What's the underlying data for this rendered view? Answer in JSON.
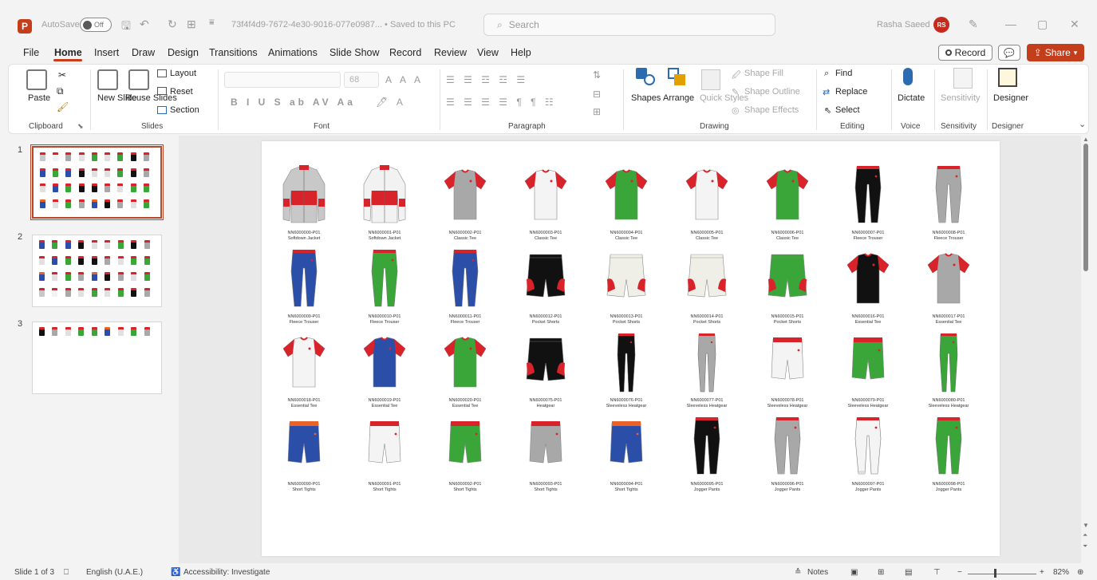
{
  "titlebar": {
    "app_letter": "P",
    "autosave_label": "AutoSave",
    "autosave_state": "Off",
    "filename": "73f4f4d9-7672-4e30-9016-077e0987... • Saved to this PC",
    "search_placeholder": "Search",
    "user_name": "Rasha Saeed",
    "user_initials": "RS"
  },
  "menu": {
    "tabs": [
      "File",
      "Home",
      "Insert",
      "Draw",
      "Design",
      "Transitions",
      "Animations",
      "Slide Show",
      "Record",
      "Review",
      "View",
      "Help"
    ],
    "active": "Home",
    "record_label": "Record",
    "share_label": "Share"
  },
  "ribbon": {
    "clipboard": {
      "paste": "Paste",
      "group": "Clipboard"
    },
    "slides": {
      "new_slide": "New Slide",
      "reuse_slides": "Reuse Slides",
      "layout": "Layout",
      "reset": "Reset",
      "section": "Section",
      "group": "Slides"
    },
    "font": {
      "size": "68",
      "group": "Font"
    },
    "paragraph": {
      "group": "Paragraph"
    },
    "drawing": {
      "shapes": "Shapes",
      "arrange": "Arrange",
      "quick_styles": "Quick Styles",
      "shape_fill": "Shape Fill",
      "shape_outline": "Shape Outline",
      "shape_effects": "Shape Effects",
      "group": "Drawing"
    },
    "editing": {
      "find": "Find",
      "replace": "Replace",
      "select": "Select",
      "group": "Editing"
    },
    "voice": {
      "dictate": "Dictate",
      "group": "Voice"
    },
    "sensitivity": {
      "label": "Sensitivity",
      "group": "Sensitivity"
    },
    "designer": {
      "label": "Designer",
      "group": "Designer"
    }
  },
  "thumbnails": [
    "1",
    "2",
    "3"
  ],
  "products": [
    {
      "code": "NN6000000-P01",
      "name": "Softdown Jacket",
      "kind": "jacket",
      "c1": "#c8c8c8",
      "c2": "#d8232a"
    },
    {
      "code": "NN6000001-P01",
      "name": "Softdown Jacket",
      "kind": "jacket",
      "c1": "#f2f2f2",
      "c2": "#d8232a"
    },
    {
      "code": "NN6000002-P01",
      "name": "Classic Tee",
      "kind": "tee",
      "c1": "#a8a8a8",
      "c2": "#d8232a"
    },
    {
      "code": "NN6000003-P01",
      "name": "Classic Tee",
      "kind": "tee",
      "c1": "#f4f4f4",
      "c2": "#d8232a"
    },
    {
      "code": "NN6000004-P01",
      "name": "Classic Tee",
      "kind": "tee",
      "c1": "#3aa63a",
      "c2": "#d8232a"
    },
    {
      "code": "NN6000005-P01",
      "name": "Classic Tee",
      "kind": "tee",
      "c1": "#f4f4f4",
      "c2": "#d8232a"
    },
    {
      "code": "NN6000006-P01",
      "name": "Classic Tee",
      "kind": "tee",
      "c1": "#3aa63a",
      "c2": "#d8232a"
    },
    {
      "code": "NN6000007-P01",
      "name": "Fleece Trouser",
      "kind": "trouser",
      "c1": "#111111",
      "c2": "#d8232a"
    },
    {
      "code": "NN6000008-P01",
      "name": "Fleece Trouser",
      "kind": "trouser",
      "c1": "#a8a8a8",
      "c2": "#d8232a"
    },
    {
      "code": "NN6000009-P01",
      "name": "Fleece Trouser",
      "kind": "trouser",
      "c1": "#2b4fa8",
      "c2": "#d8232a"
    },
    {
      "code": "NN6000010-P01",
      "name": "Fleece Trouser",
      "kind": "trouser",
      "c1": "#3aa63a",
      "c2": "#d8232a"
    },
    {
      "code": "NN6000011-P01",
      "name": "Fleece Trouser",
      "kind": "trouser",
      "c1": "#2b4fa8",
      "c2": "#d8232a"
    },
    {
      "code": "NN6000012-P01",
      "name": "Pocket Shorts",
      "kind": "shorts",
      "c1": "#111111",
      "c2": "#d8232a"
    },
    {
      "code": "NN6000013-P01",
      "name": "Pocket Shorts",
      "kind": "shorts",
      "c1": "#efefe8",
      "c2": "#d8232a"
    },
    {
      "code": "NN6000014-P01",
      "name": "Pocket Shorts",
      "kind": "shorts",
      "c1": "#efefe8",
      "c2": "#d8232a"
    },
    {
      "code": "NN6000015-P01",
      "name": "Pocket Shorts",
      "kind": "shorts",
      "c1": "#3aa63a",
      "c2": "#d8232a"
    },
    {
      "code": "NN6000016-P01",
      "name": "Essential Tee",
      "kind": "tee",
      "c1": "#111111",
      "c2": "#d8232a"
    },
    {
      "code": "NN6000017-P01",
      "name": "Essential Tee",
      "kind": "tee",
      "c1": "#a8a8a8",
      "c2": "#d8232a"
    },
    {
      "code": "NN6000018-P01",
      "name": "Essential Tee",
      "kind": "tee",
      "c1": "#f4f4f4",
      "c2": "#d8232a"
    },
    {
      "code": "NN6000019-P01",
      "name": "Essential Tee",
      "kind": "tee",
      "c1": "#2b4fa8",
      "c2": "#d8232a"
    },
    {
      "code": "NN6000020-P01",
      "name": "Essential Tee",
      "kind": "tee",
      "c1": "#3aa63a",
      "c2": "#d8232a"
    },
    {
      "code": "NN6000075-P01",
      "name": "Heatgear",
      "kind": "shorts",
      "c1": "#111111",
      "c2": "#d8232a"
    },
    {
      "code": "NN6000076-P01",
      "name": "Sleeveless Heatgear",
      "kind": "legging",
      "c1": "#111111",
      "c2": "#d8232a"
    },
    {
      "code": "NN6000077-P01",
      "name": "Sleeveless Heatgear",
      "kind": "legging",
      "c1": "#a8a8a8",
      "c2": "#d8232a"
    },
    {
      "code": "NN6000078-P01",
      "name": "Sleeveless Heatgear",
      "kind": "tight",
      "c1": "#f4f4f4",
      "c2": "#d8232a"
    },
    {
      "code": "NN6000079-P01",
      "name": "Sleeveless Heatgear",
      "kind": "tight",
      "c1": "#3aa63a",
      "c2": "#d8232a"
    },
    {
      "code": "NN6000080-P01",
      "name": "Sleeveless Heatgear",
      "kind": "legging",
      "c1": "#3aa63a",
      "c2": "#d8232a"
    },
    {
      "code": "NN6000090-P01",
      "name": "Short Tights",
      "kind": "tight",
      "c1": "#2b4fa8",
      "c2": "#e8622a"
    },
    {
      "code": "NN6000091-P01",
      "name": "Short Tights",
      "kind": "tight",
      "c1": "#f4f4f4",
      "c2": "#d8232a"
    },
    {
      "code": "NN6000092-P01",
      "name": "Short Tights",
      "kind": "tight",
      "c1": "#3aa63a",
      "c2": "#d8232a"
    },
    {
      "code": "NN6000093-P01",
      "name": "Short Tights",
      "kind": "tight",
      "c1": "#a8a8a8",
      "c2": "#d8232a"
    },
    {
      "code": "NN6000094-P01",
      "name": "Short Tights",
      "kind": "tight",
      "c1": "#2b4fa8",
      "c2": "#e8622a"
    },
    {
      "code": "NN6000095-P01",
      "name": "Jogger Pants",
      "kind": "trouser",
      "c1": "#111111",
      "c2": "#d8232a"
    },
    {
      "code": "NN6000096-P01",
      "name": "Jogger Pants",
      "kind": "trouser",
      "c1": "#a8a8a8",
      "c2": "#d8232a"
    },
    {
      "code": "NN6000097-P01",
      "name": "Jogger Pants",
      "kind": "trouser",
      "c1": "#f4f4f4",
      "c2": "#d8232a"
    },
    {
      "code": "NN6000098-P01",
      "name": "Jogger Pants",
      "kind": "trouser",
      "c1": "#3aa63a",
      "c2": "#d8232a"
    }
  ],
  "status": {
    "slide_info": "Slide 1 of 3",
    "language": "English (U.A.E.)",
    "accessibility": "Accessibility: Investigate",
    "notes": "Notes",
    "zoom": "82%"
  },
  "colors": {
    "accent": "#c43e1c",
    "selection": "#b7472a"
  }
}
